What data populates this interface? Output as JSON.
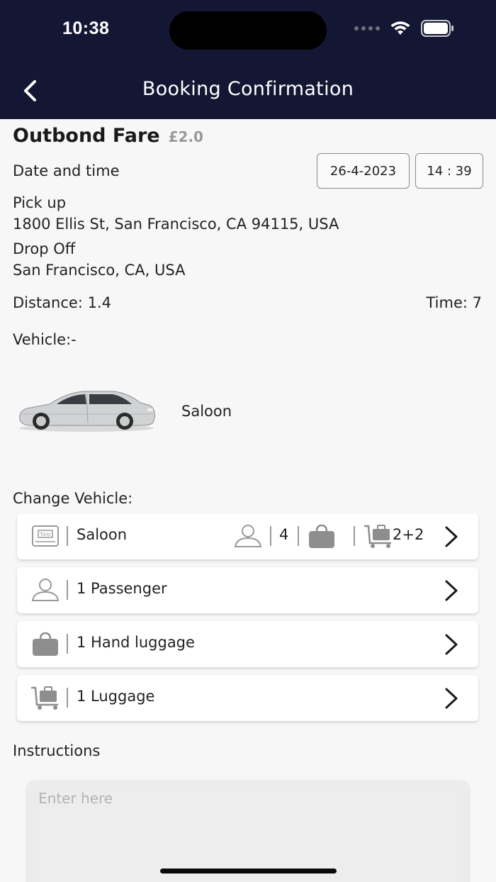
{
  "status_bar": {
    "time": "10:38"
  },
  "nav": {
    "title": "Booking Confirmation"
  },
  "fare": {
    "label": "Outbond Fare",
    "value": "£2.0"
  },
  "date_time": {
    "label": "Date and time",
    "date": "26-4-2023",
    "time": "14 : 39"
  },
  "pickup": {
    "label": "Pick up",
    "address": "1800 Ellis St, San Francisco, CA 94115, USA"
  },
  "dropoff": {
    "label": "Drop Off",
    "address": "San Francisco, CA, USA"
  },
  "trip": {
    "distance": "Distance: 1.4",
    "time": "Time: 7"
  },
  "vehicle": {
    "label": "Vehicle:-",
    "name": "Saloon"
  },
  "change_vehicle": {
    "label": "Change Vehicle:",
    "vehicle_option": {
      "name": "Saloon",
      "passengers": "4",
      "luggage": "2+2"
    },
    "passengers": "1 Passenger",
    "hand_luggage": "1 Hand luggage",
    "luggage": "1 Luggage"
  },
  "instructions": {
    "label": "Instructions",
    "placeholder": "Enter here"
  },
  "colors": {
    "header_bg": "#141733",
    "icon_gray": "#9a9a9a"
  }
}
